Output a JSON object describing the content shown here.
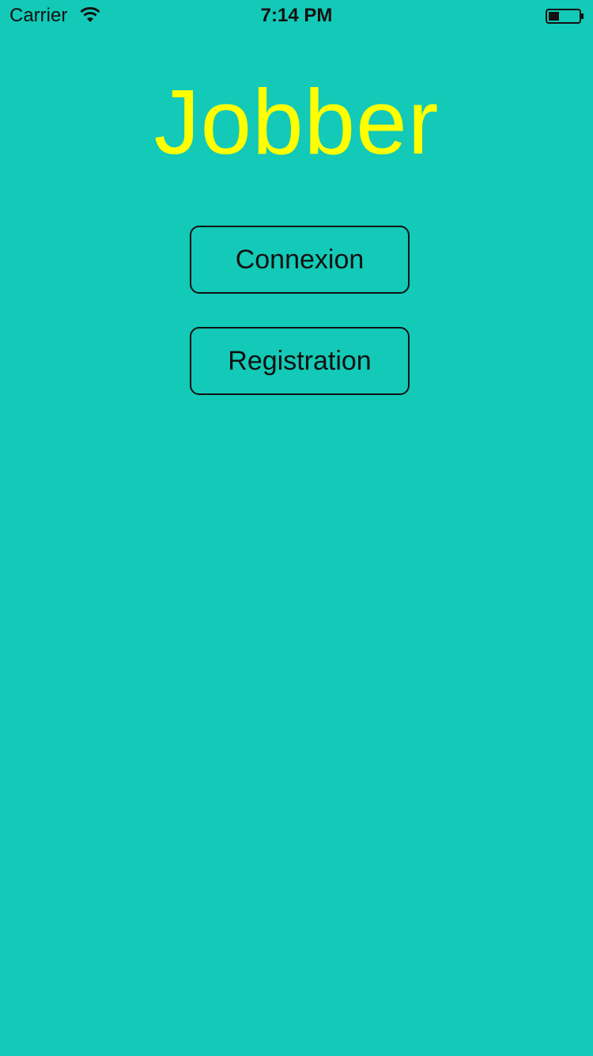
{
  "status_bar": {
    "carrier": "Carrier",
    "time": "7:14 PM",
    "wifi_icon": "wifi-icon",
    "battery_icon": "battery-icon"
  },
  "app": {
    "title": "Jobber",
    "title_color": "#ffff00",
    "background_color": "#13c9b7"
  },
  "buttons": {
    "connexion": "Connexion",
    "registration": "Registration"
  }
}
